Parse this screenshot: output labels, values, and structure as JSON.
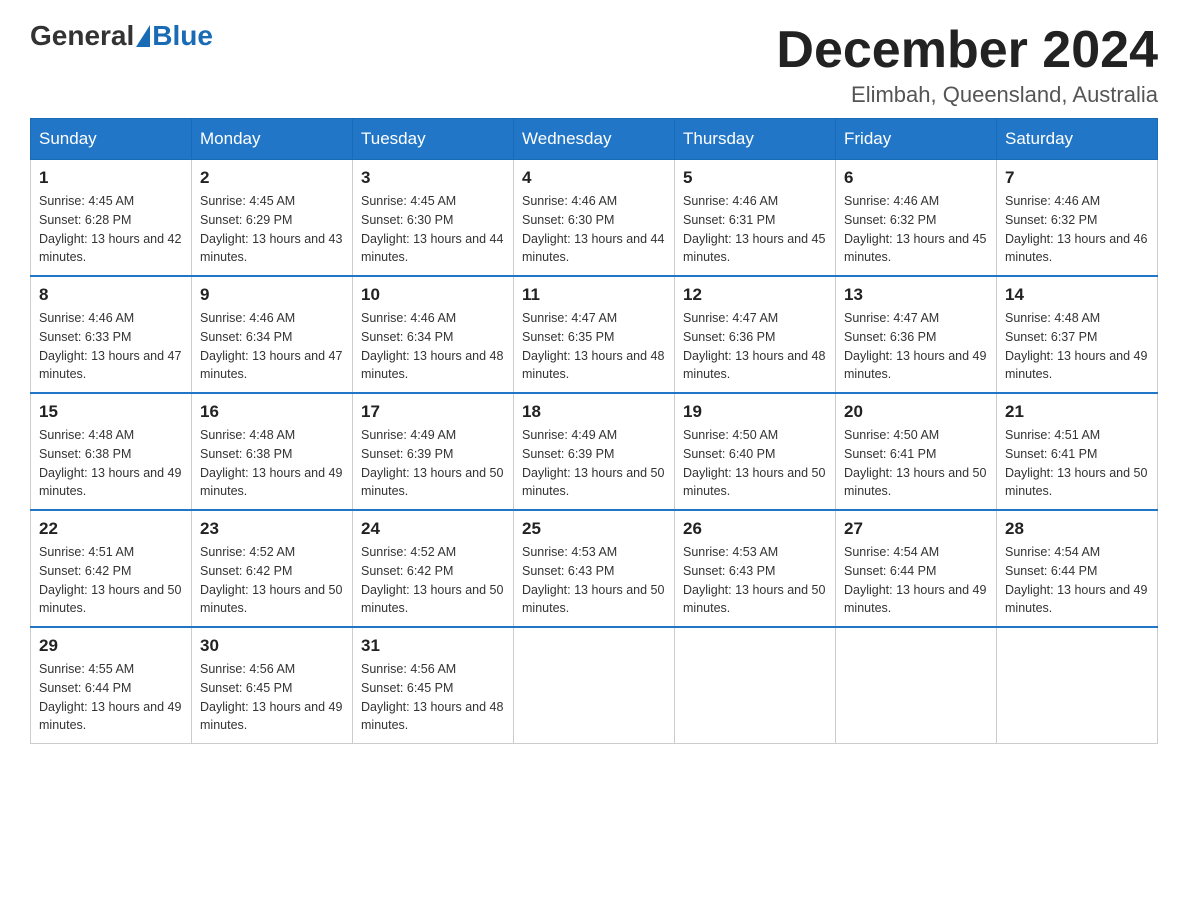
{
  "header": {
    "logo": {
      "general": "General",
      "blue": "Blue"
    },
    "title": "December 2024",
    "location": "Elimbah, Queensland, Australia"
  },
  "calendar": {
    "days_of_week": [
      "Sunday",
      "Monday",
      "Tuesday",
      "Wednesday",
      "Thursday",
      "Friday",
      "Saturday"
    ],
    "weeks": [
      [
        {
          "day": "1",
          "sunrise": "4:45 AM",
          "sunset": "6:28 PM",
          "daylight": "13 hours and 42 minutes."
        },
        {
          "day": "2",
          "sunrise": "4:45 AM",
          "sunset": "6:29 PM",
          "daylight": "13 hours and 43 minutes."
        },
        {
          "day": "3",
          "sunrise": "4:45 AM",
          "sunset": "6:30 PM",
          "daylight": "13 hours and 44 minutes."
        },
        {
          "day": "4",
          "sunrise": "4:46 AM",
          "sunset": "6:30 PM",
          "daylight": "13 hours and 44 minutes."
        },
        {
          "day": "5",
          "sunrise": "4:46 AM",
          "sunset": "6:31 PM",
          "daylight": "13 hours and 45 minutes."
        },
        {
          "day": "6",
          "sunrise": "4:46 AM",
          "sunset": "6:32 PM",
          "daylight": "13 hours and 45 minutes."
        },
        {
          "day": "7",
          "sunrise": "4:46 AM",
          "sunset": "6:32 PM",
          "daylight": "13 hours and 46 minutes."
        }
      ],
      [
        {
          "day": "8",
          "sunrise": "4:46 AM",
          "sunset": "6:33 PM",
          "daylight": "13 hours and 47 minutes."
        },
        {
          "day": "9",
          "sunrise": "4:46 AM",
          "sunset": "6:34 PM",
          "daylight": "13 hours and 47 minutes."
        },
        {
          "day": "10",
          "sunrise": "4:46 AM",
          "sunset": "6:34 PM",
          "daylight": "13 hours and 48 minutes."
        },
        {
          "day": "11",
          "sunrise": "4:47 AM",
          "sunset": "6:35 PM",
          "daylight": "13 hours and 48 minutes."
        },
        {
          "day": "12",
          "sunrise": "4:47 AM",
          "sunset": "6:36 PM",
          "daylight": "13 hours and 48 minutes."
        },
        {
          "day": "13",
          "sunrise": "4:47 AM",
          "sunset": "6:36 PM",
          "daylight": "13 hours and 49 minutes."
        },
        {
          "day": "14",
          "sunrise": "4:48 AM",
          "sunset": "6:37 PM",
          "daylight": "13 hours and 49 minutes."
        }
      ],
      [
        {
          "day": "15",
          "sunrise": "4:48 AM",
          "sunset": "6:38 PM",
          "daylight": "13 hours and 49 minutes."
        },
        {
          "day": "16",
          "sunrise": "4:48 AM",
          "sunset": "6:38 PM",
          "daylight": "13 hours and 49 minutes."
        },
        {
          "day": "17",
          "sunrise": "4:49 AM",
          "sunset": "6:39 PM",
          "daylight": "13 hours and 50 minutes."
        },
        {
          "day": "18",
          "sunrise": "4:49 AM",
          "sunset": "6:39 PM",
          "daylight": "13 hours and 50 minutes."
        },
        {
          "day": "19",
          "sunrise": "4:50 AM",
          "sunset": "6:40 PM",
          "daylight": "13 hours and 50 minutes."
        },
        {
          "day": "20",
          "sunrise": "4:50 AM",
          "sunset": "6:41 PM",
          "daylight": "13 hours and 50 minutes."
        },
        {
          "day": "21",
          "sunrise": "4:51 AM",
          "sunset": "6:41 PM",
          "daylight": "13 hours and 50 minutes."
        }
      ],
      [
        {
          "day": "22",
          "sunrise": "4:51 AM",
          "sunset": "6:42 PM",
          "daylight": "13 hours and 50 minutes."
        },
        {
          "day": "23",
          "sunrise": "4:52 AM",
          "sunset": "6:42 PM",
          "daylight": "13 hours and 50 minutes."
        },
        {
          "day": "24",
          "sunrise": "4:52 AM",
          "sunset": "6:42 PM",
          "daylight": "13 hours and 50 minutes."
        },
        {
          "day": "25",
          "sunrise": "4:53 AM",
          "sunset": "6:43 PM",
          "daylight": "13 hours and 50 minutes."
        },
        {
          "day": "26",
          "sunrise": "4:53 AM",
          "sunset": "6:43 PM",
          "daylight": "13 hours and 50 minutes."
        },
        {
          "day": "27",
          "sunrise": "4:54 AM",
          "sunset": "6:44 PM",
          "daylight": "13 hours and 49 minutes."
        },
        {
          "day": "28",
          "sunrise": "4:54 AM",
          "sunset": "6:44 PM",
          "daylight": "13 hours and 49 minutes."
        }
      ],
      [
        {
          "day": "29",
          "sunrise": "4:55 AM",
          "sunset": "6:44 PM",
          "daylight": "13 hours and 49 minutes."
        },
        {
          "day": "30",
          "sunrise": "4:56 AM",
          "sunset": "6:45 PM",
          "daylight": "13 hours and 49 minutes."
        },
        {
          "day": "31",
          "sunrise": "4:56 AM",
          "sunset": "6:45 PM",
          "daylight": "13 hours and 48 minutes."
        },
        null,
        null,
        null,
        null
      ]
    ]
  }
}
